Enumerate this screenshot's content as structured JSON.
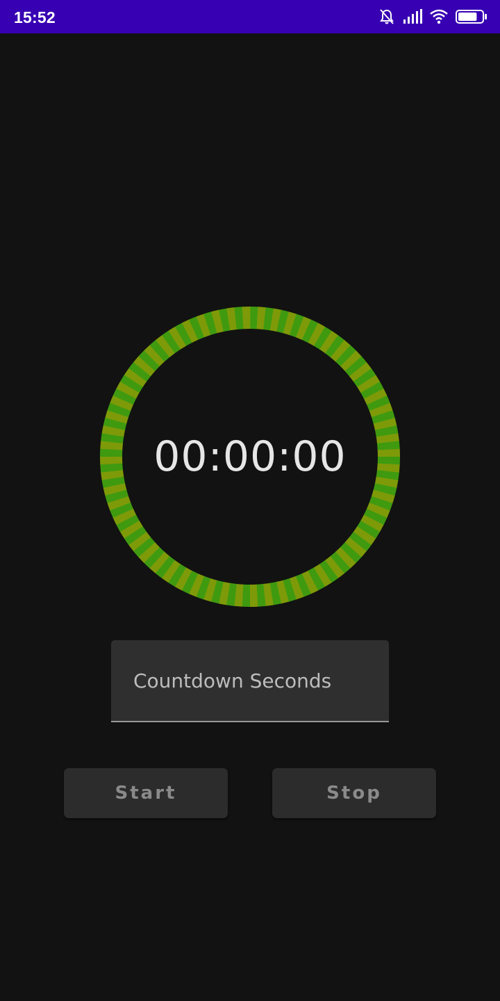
{
  "status_bar": {
    "time": "15:52",
    "icons": [
      "mute-icon",
      "signal-icon",
      "wifi-icon",
      "battery-icon"
    ],
    "battery_level": 0.8
  },
  "timer": {
    "display": "00:00:00",
    "ring_colors": [
      "#3f9a10",
      "#7e9a08"
    ],
    "progress": 1.0
  },
  "countdown_input": {
    "placeholder": "Countdown Seconds",
    "value": ""
  },
  "buttons": {
    "start_label": "Start",
    "stop_label": "Stop"
  },
  "colors": {
    "status_bar": "#3700b3",
    "background": "#121212"
  }
}
